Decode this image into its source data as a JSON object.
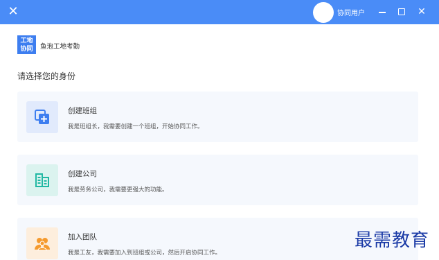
{
  "titlebar": {
    "user_name": "协同用户",
    "bg_color": "#4a8cf7"
  },
  "brand": {
    "logo_line1": "工地",
    "logo_line2": "协同",
    "app_name": "鱼泡工地考勤"
  },
  "page": {
    "section_title": "请选择您的身份"
  },
  "options": [
    {
      "title": "创建班组",
      "desc": "我是班组长，我需要创建一个班组，开始协同工作。",
      "icon": "team-add-icon",
      "color": "#3d7ef0"
    },
    {
      "title": "创建公司",
      "desc": "我是劳务公司，我需要更强大的功能。",
      "icon": "building-icon",
      "color": "#21b8a3"
    },
    {
      "title": "加入团队",
      "desc": "我是工友，我需要加入到班组或公司，然后开启协同工作。",
      "icon": "people-icon",
      "color": "#f59a2e"
    }
  ],
  "watermark": "最需教育"
}
